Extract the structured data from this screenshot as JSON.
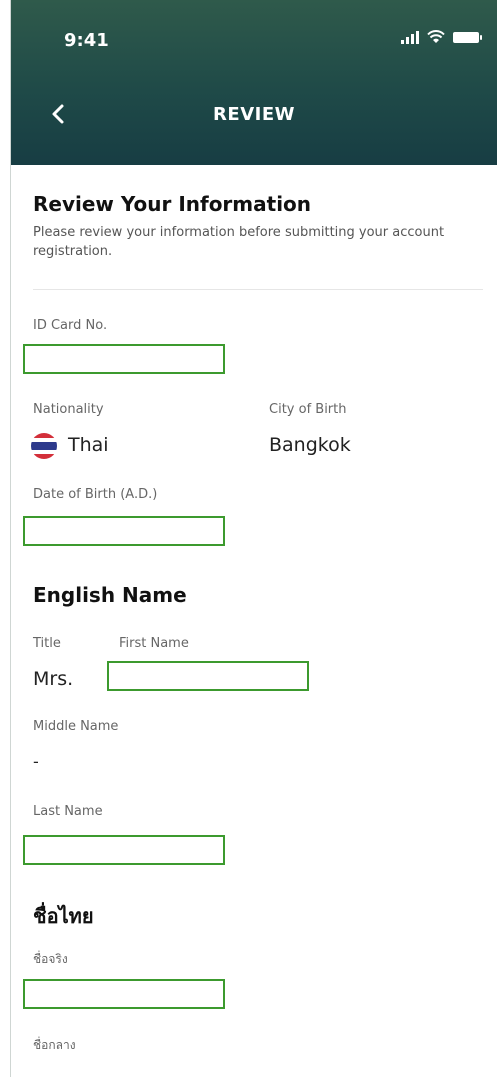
{
  "status_bar": {
    "time": "9:41"
  },
  "header": {
    "title": "REVIEW"
  },
  "review": {
    "heading": "Review Your Information",
    "subtitle": "Please review your information before submitting your account registration."
  },
  "fields": {
    "id_card": {
      "label": "ID Card No.",
      "value": ""
    },
    "nationality": {
      "label": "Nationality",
      "value": "Thai"
    },
    "city_of_birth": {
      "label": "City of Birth",
      "value": "Bangkok"
    },
    "date_of_birth": {
      "label": "Date of Birth (A.D.)",
      "value": ""
    }
  },
  "english_name": {
    "heading": "English Name",
    "title_label": "Title",
    "title_value": "Mrs.",
    "first_name_label": "First Name",
    "first_name_value": "",
    "middle_name_label": "Middle Name",
    "middle_name_value": "-",
    "last_name_label": "Last Name",
    "last_name_value": ""
  },
  "thai_name": {
    "heading": "ชื่อไทย",
    "first_name_label": "ชื่อจริง",
    "first_name_value": "",
    "middle_name_label": "ชื่อกลาง"
  },
  "colors": {
    "highlight_box": "#3c9a2e",
    "header_gradient": "#1f4a48"
  },
  "icons": {
    "back": "chevron-left-icon",
    "flag": "thai-flag-icon"
  }
}
